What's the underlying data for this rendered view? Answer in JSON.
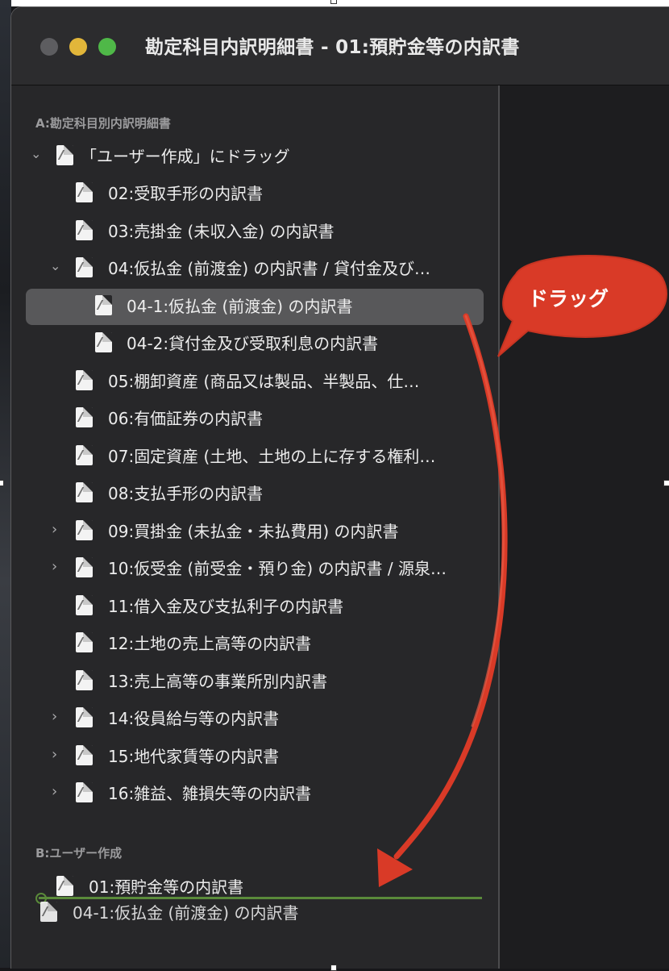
{
  "window": {
    "title": "勘定科目内訳明細書 - 01:預貯金等の内訳書"
  },
  "sidebar": {
    "section_a": "A:勘定科目別内訳明細書",
    "section_b": "B:ユーザー作成",
    "items_a": [
      {
        "label": "「ユーザー作成」にドラッグ",
        "expanded": true
      },
      {
        "label": "02:受取手形の内訳書"
      },
      {
        "label": "03:売掛金 (未収入金) の内訳書"
      },
      {
        "label": "04:仮払金 (前渡金) の内訳書 / 貸付金及び…",
        "expanded": true
      },
      {
        "label": "04-1:仮払金 (前渡金) の内訳書",
        "selected": true
      },
      {
        "label": "04-2:貸付金及び受取利息の内訳書"
      },
      {
        "label": "05:棚卸資産 (商品又は製品、半製品、仕…"
      },
      {
        "label": "06:有価証券の内訳書"
      },
      {
        "label": "07:固定資産 (土地、土地の上に存する権利…"
      },
      {
        "label": "08:支払手形の内訳書"
      },
      {
        "label": "09:買掛金 (未払金・未払費用) の内訳書",
        "expanded": false
      },
      {
        "label": "10:仮受金 (前受金・預り金) の内訳書 / 源泉…",
        "expanded": false
      },
      {
        "label": "11:借入金及び支払利子の内訳書"
      },
      {
        "label": "12:土地の売上高等の内訳書"
      },
      {
        "label": "13:売上高等の事業所別内訳書"
      },
      {
        "label": "14:役員給与等の内訳書",
        "expanded": false
      },
      {
        "label": "15:地代家賃等の内訳書",
        "expanded": false
      },
      {
        "label": "16:雑益、雑損失等の内訳書",
        "expanded": false
      }
    ],
    "items_b": [
      {
        "label": "01:預貯金等の内訳書"
      }
    ],
    "drag_ghost": "04-1:仮払金 (前渡金) の内訳書"
  },
  "annotation": {
    "callout": "ドラッグ",
    "color": "#d93a27"
  },
  "icons": {
    "document": "document-icon",
    "chevron_down": "chevron-down-icon",
    "chevron_right": "chevron-right-icon"
  }
}
